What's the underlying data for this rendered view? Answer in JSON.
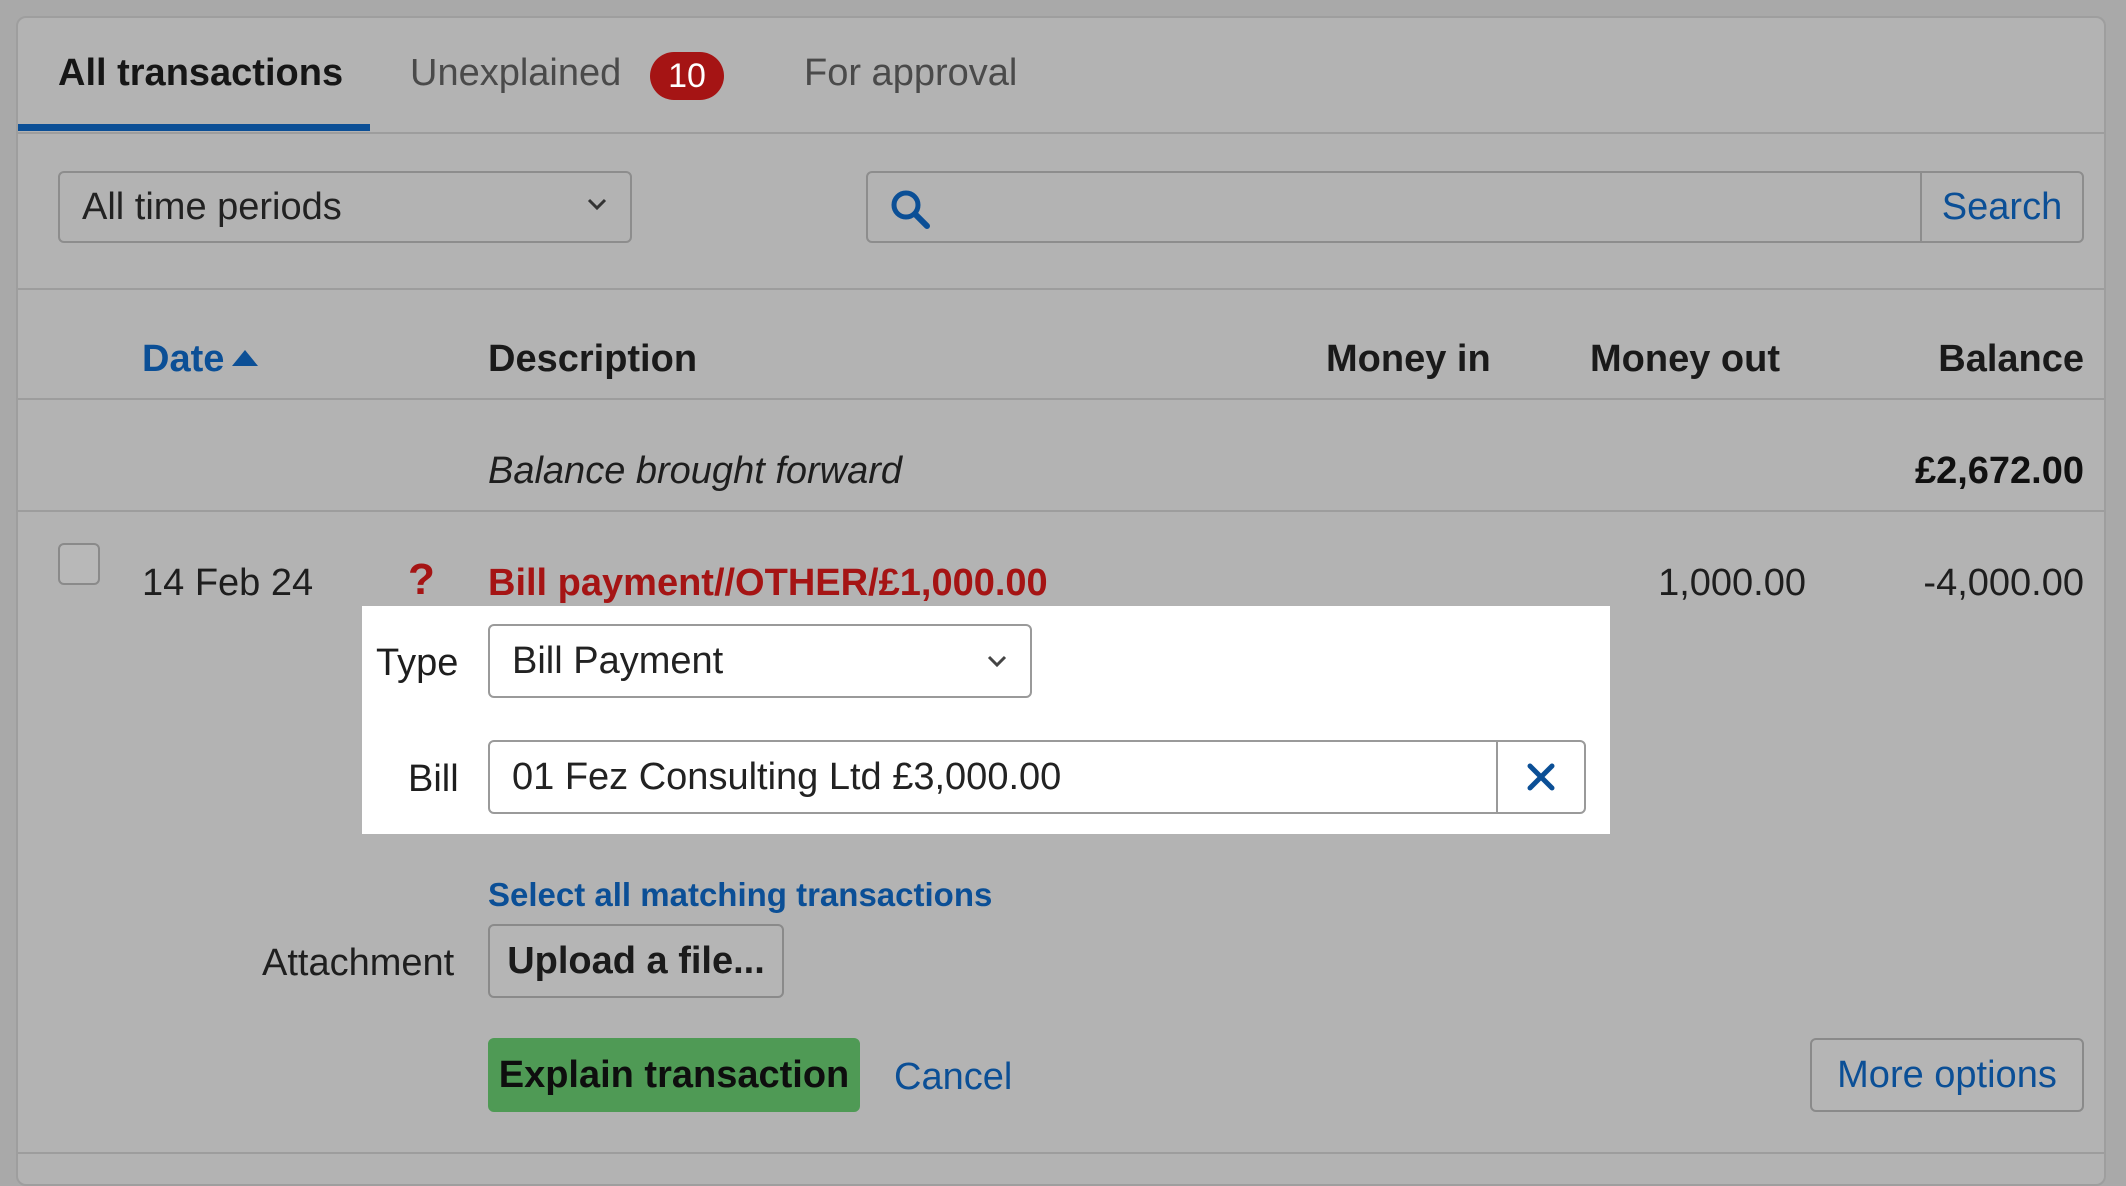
{
  "tabs": [
    {
      "label": "All transactions",
      "active": true
    },
    {
      "label": "Unexplained",
      "badge": "10"
    },
    {
      "label": "For approval"
    }
  ],
  "filters": {
    "period_value": "All time periods",
    "search_placeholder": "",
    "search_button": "Search"
  },
  "table": {
    "headers": {
      "date": "Date",
      "description": "Description",
      "money_in": "Money in",
      "money_out": "Money out",
      "balance": "Balance"
    },
    "brought_forward": {
      "label": "Balance brought forward",
      "amount": "£2,672.00"
    },
    "row": {
      "date": "14 Feb 24",
      "status_glyph": "?",
      "description": "Bill payment//OTHER/£1,000.00",
      "money_out": "1,000.00",
      "balance": "-4,000.00"
    }
  },
  "explain_form": {
    "type_label": "Type",
    "type_value": "Bill Payment",
    "bill_label": "Bill",
    "bill_value": "01 Fez Consulting Ltd £3,000.00",
    "select_matching_link": "Select all matching transactions",
    "attachment_label": "Attachment",
    "upload_button": "Upload a file...",
    "explain_button": "Explain transaction",
    "cancel_link": "Cancel",
    "more_options_button": "More options"
  },
  "colors": {
    "accent_blue": "#0b4f96",
    "error_red": "#a51414",
    "success_green": "#4f9a55"
  }
}
